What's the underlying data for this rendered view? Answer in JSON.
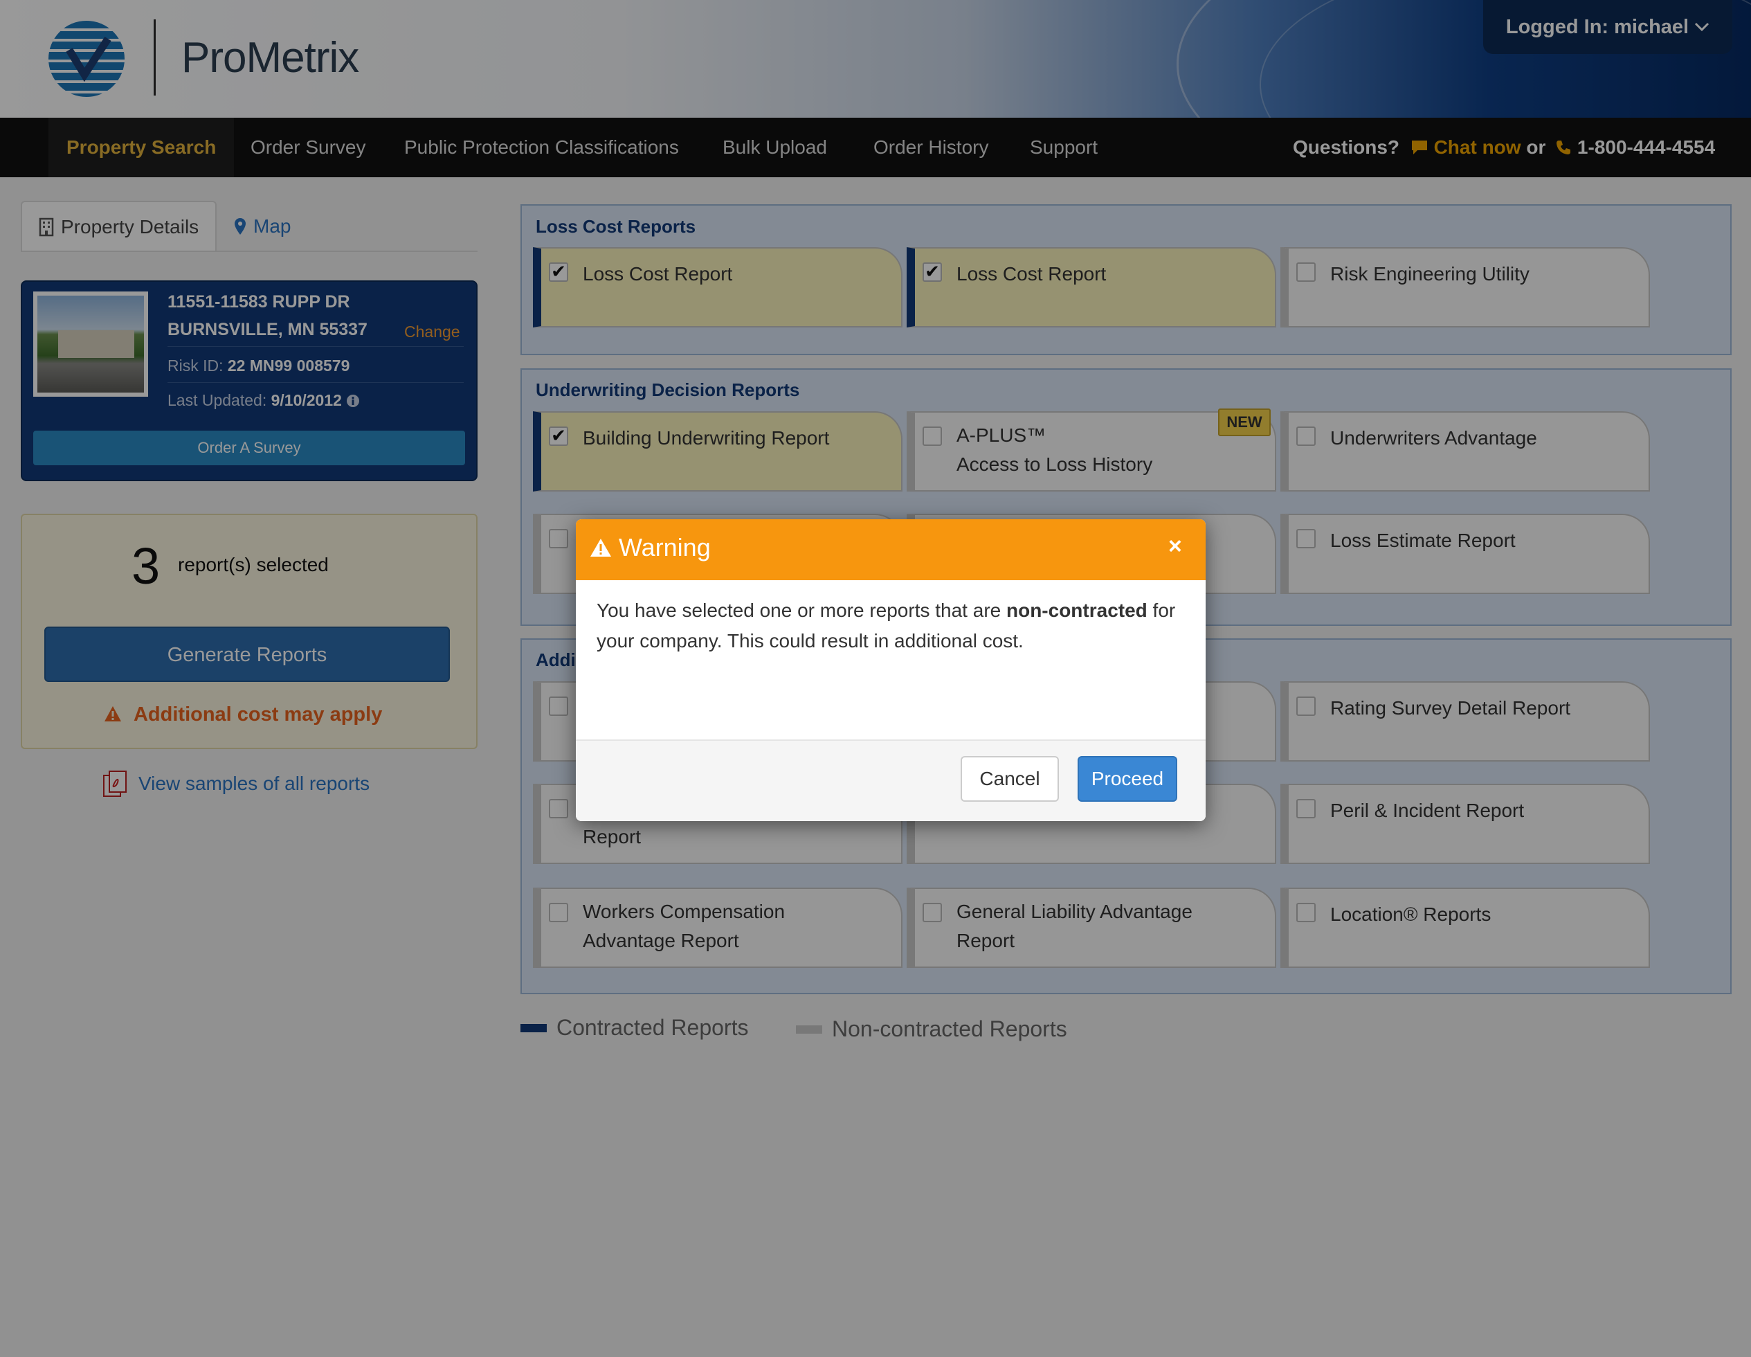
{
  "brand": {
    "name": "ProMetrix",
    "logo_icon": "prometrix-check-globe-icon"
  },
  "header": {
    "user_menu": "Logged In: michael"
  },
  "nav": {
    "items": [
      "Property Search",
      "Order Survey",
      "Public Protection Classifications",
      "Bulk Upload",
      "Order History",
      "Support"
    ],
    "active": "Property Search",
    "questions": "Questions?",
    "chat": "Chat now",
    "or": "or",
    "phone": "1-800-444-4554"
  },
  "left_tabs": {
    "details": "Property Details",
    "map": "Map"
  },
  "property": {
    "address_line1": "11551-11583 RUPP DR",
    "address_line2": "BURNSVILLE, MN 55337",
    "change": "Change",
    "risk_label": "Risk ID:",
    "risk_id": "22 MN99 008579",
    "updated_label": "Last Updated:",
    "updated": "9/10/2012",
    "order_survey": "Order A Survey"
  },
  "selection": {
    "count": "3",
    "label": "report(s) selected",
    "generate": "Generate Reports",
    "cost_warning": "Additional cost may apply"
  },
  "samples_link": "View samples of all reports",
  "sections": {
    "loss_cost": {
      "title": "Loss Cost Reports",
      "cards": [
        {
          "label": "Loss Cost Report",
          "checked": true,
          "contracted": true
        },
        {
          "label": "Loss Cost Report",
          "checked": true,
          "contracted": true
        },
        {
          "label": "Risk Engineering Utility",
          "checked": false,
          "contracted": false
        }
      ]
    },
    "underwriting": {
      "title": "Underwriting Decision Reports",
      "cards": [
        {
          "label": "Building Underwriting Report",
          "checked": true,
          "contracted": true
        },
        {
          "label_line1": "A-PLUS™",
          "label_line2": "Access to Loss History",
          "checked": false,
          "badge": "NEW"
        },
        {
          "label": "Underwriters Advantage",
          "checked": false
        },
        {
          "label": "",
          "checked": false
        },
        {
          "label": "",
          "checked": false
        },
        {
          "label": "Loss Estimate Report",
          "checked": false
        }
      ]
    },
    "additional": {
      "title": "Addi",
      "cards": [
        {
          "label": "",
          "checked": false
        },
        {
          "label": "",
          "checked": false
        },
        {
          "label": "Rating Survey Detail Report",
          "checked": false
        },
        {
          "label": "Report",
          "checked": false
        },
        {
          "label": "",
          "checked": false
        },
        {
          "label": "Peril & Incident Report",
          "checked": false
        },
        {
          "label_line1": "Workers Compensation",
          "label_line2": "Advantage Report",
          "checked": false
        },
        {
          "label_line1": "General Liability Advantage",
          "label_line2": "Report",
          "checked": false
        },
        {
          "label": "Location® Reports",
          "checked": false
        }
      ]
    }
  },
  "legend": {
    "contracted": "Contracted Reports",
    "non_contracted": "Non-contracted Reports"
  },
  "colors": {
    "contracted": "#123a78",
    "non_contracted": "#c9c9c9",
    "warning": "#f7960e",
    "accent": "#e3b23c",
    "primary": "#3a87d4"
  },
  "modal": {
    "title": "Warning",
    "text_before": "You have selected one or more reports that are ",
    "text_bold": "non-contracted",
    "text_after": " for your company. This could result in additional cost.",
    "cancel": "Cancel",
    "proceed": "Proceed"
  }
}
